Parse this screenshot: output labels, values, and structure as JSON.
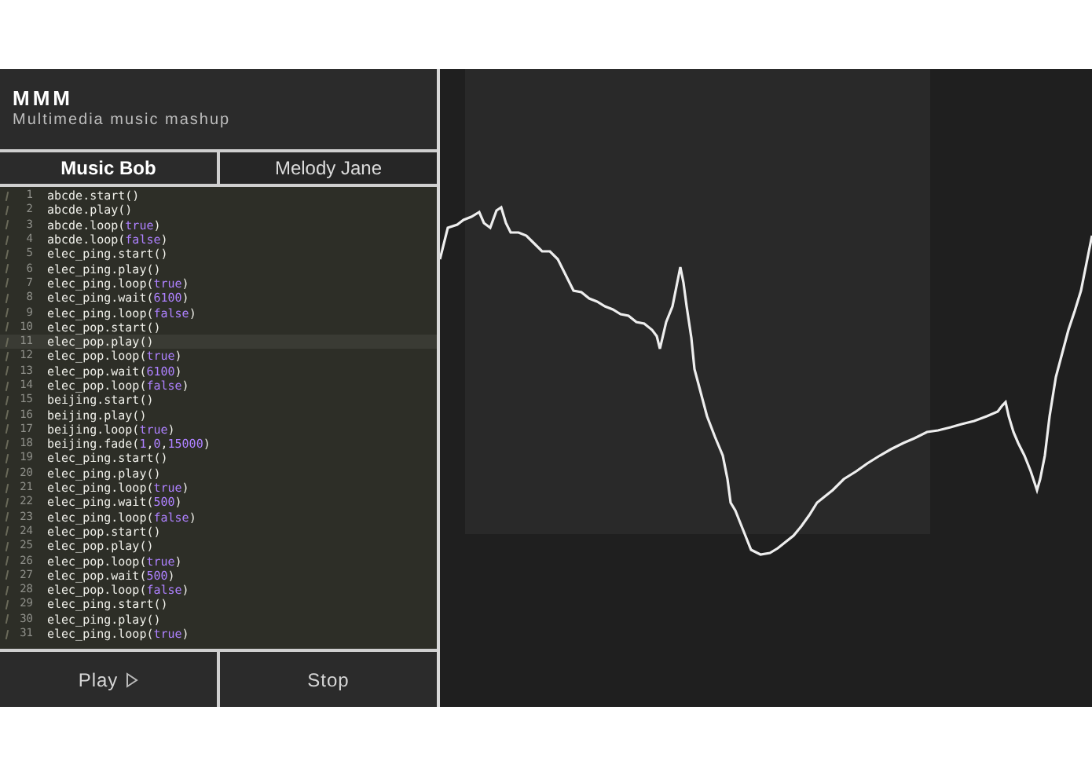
{
  "app": {
    "title": "MMM",
    "subtitle": "Multimedia music mashup"
  },
  "tabs": [
    {
      "label": "Music Bob",
      "selected": true
    },
    {
      "label": "Melody Jane",
      "selected": false
    }
  ],
  "editor": {
    "lines": [
      {
        "number": "1",
        "selected": false,
        "tokens": [
          {
            "text": "abcde.start()",
            "kind": "plain"
          }
        ]
      },
      {
        "number": "2",
        "selected": false,
        "tokens": [
          {
            "text": "abcde.play()",
            "kind": "plain"
          }
        ]
      },
      {
        "number": "3",
        "selected": false,
        "tokens": [
          {
            "text": "abcde.loop(",
            "kind": "plain"
          },
          {
            "text": "true",
            "kind": "literal"
          },
          {
            "text": ")",
            "kind": "plain"
          }
        ]
      },
      {
        "number": "4",
        "selected": false,
        "tokens": [
          {
            "text": "abcde.loop(",
            "kind": "plain"
          },
          {
            "text": "false",
            "kind": "literal"
          },
          {
            "text": ")",
            "kind": "plain"
          }
        ]
      },
      {
        "number": "5",
        "selected": false,
        "tokens": [
          {
            "text": "elec_ping.start()",
            "kind": "plain"
          }
        ]
      },
      {
        "number": "6",
        "selected": false,
        "tokens": [
          {
            "text": "elec_ping.play()",
            "kind": "plain"
          }
        ]
      },
      {
        "number": "7",
        "selected": false,
        "tokens": [
          {
            "text": "elec_ping.loop(",
            "kind": "plain"
          },
          {
            "text": "true",
            "kind": "literal"
          },
          {
            "text": ")",
            "kind": "plain"
          }
        ]
      },
      {
        "number": "8",
        "selected": false,
        "tokens": [
          {
            "text": "elec_ping.wait(",
            "kind": "plain"
          },
          {
            "text": "6100",
            "kind": "literal"
          },
          {
            "text": ")",
            "kind": "plain"
          }
        ]
      },
      {
        "number": "9",
        "selected": false,
        "tokens": [
          {
            "text": "elec_ping.loop(",
            "kind": "plain"
          },
          {
            "text": "false",
            "kind": "literal"
          },
          {
            "text": ")",
            "kind": "plain"
          }
        ]
      },
      {
        "number": "10",
        "selected": false,
        "tokens": [
          {
            "text": "elec_pop.start()",
            "kind": "plain"
          }
        ]
      },
      {
        "number": "11",
        "selected": true,
        "tokens": [
          {
            "text": "elec_pop.play()",
            "kind": "plain"
          }
        ]
      },
      {
        "number": "12",
        "selected": false,
        "tokens": [
          {
            "text": "elec_pop.loop(",
            "kind": "plain"
          },
          {
            "text": "true",
            "kind": "literal"
          },
          {
            "text": ")",
            "kind": "plain"
          }
        ]
      },
      {
        "number": "13",
        "selected": false,
        "tokens": [
          {
            "text": "elec_pop.wait(",
            "kind": "plain"
          },
          {
            "text": "6100",
            "kind": "literal"
          },
          {
            "text": ")",
            "kind": "plain"
          }
        ]
      },
      {
        "number": "14",
        "selected": false,
        "tokens": [
          {
            "text": "elec_pop.loop(",
            "kind": "plain"
          },
          {
            "text": "false",
            "kind": "literal"
          },
          {
            "text": ")",
            "kind": "plain"
          }
        ]
      },
      {
        "number": "15",
        "selected": false,
        "tokens": [
          {
            "text": "beijing.start()",
            "kind": "plain"
          }
        ]
      },
      {
        "number": "16",
        "selected": false,
        "tokens": [
          {
            "text": "beijing.play()",
            "kind": "plain"
          }
        ]
      },
      {
        "number": "17",
        "selected": false,
        "tokens": [
          {
            "text": "beijing.loop(",
            "kind": "plain"
          },
          {
            "text": "true",
            "kind": "literal"
          },
          {
            "text": ")",
            "kind": "plain"
          }
        ]
      },
      {
        "number": "18",
        "selected": false,
        "tokens": [
          {
            "text": "beijing.fade(",
            "kind": "plain"
          },
          {
            "text": "1",
            "kind": "literal"
          },
          {
            "text": ",",
            "kind": "plain"
          },
          {
            "text": "0",
            "kind": "literal"
          },
          {
            "text": ",",
            "kind": "plain"
          },
          {
            "text": "15000",
            "kind": "literal"
          },
          {
            "text": ")",
            "kind": "plain"
          }
        ]
      },
      {
        "number": "19",
        "selected": false,
        "tokens": [
          {
            "text": "elec_ping.start()",
            "kind": "plain"
          }
        ]
      },
      {
        "number": "20",
        "selected": false,
        "tokens": [
          {
            "text": "elec_ping.play()",
            "kind": "plain"
          }
        ]
      },
      {
        "number": "21",
        "selected": false,
        "tokens": [
          {
            "text": "elec_ping.loop(",
            "kind": "plain"
          },
          {
            "text": "true",
            "kind": "literal"
          },
          {
            "text": ")",
            "kind": "plain"
          }
        ]
      },
      {
        "number": "22",
        "selected": false,
        "tokens": [
          {
            "text": "elec_ping.wait(",
            "kind": "plain"
          },
          {
            "text": "500",
            "kind": "literal"
          },
          {
            "text": ")",
            "kind": "plain"
          }
        ]
      },
      {
        "number": "23",
        "selected": false,
        "tokens": [
          {
            "text": "elec_ping.loop(",
            "kind": "plain"
          },
          {
            "text": "false",
            "kind": "literal"
          },
          {
            "text": ")",
            "kind": "plain"
          }
        ]
      },
      {
        "number": "24",
        "selected": false,
        "tokens": [
          {
            "text": "elec_pop.start()",
            "kind": "plain"
          }
        ]
      },
      {
        "number": "25",
        "selected": false,
        "tokens": [
          {
            "text": "elec_pop.play()",
            "kind": "plain"
          }
        ]
      },
      {
        "number": "26",
        "selected": false,
        "tokens": [
          {
            "text": "elec_pop.loop(",
            "kind": "plain"
          },
          {
            "text": "true",
            "kind": "literal"
          },
          {
            "text": ")",
            "kind": "plain"
          }
        ]
      },
      {
        "number": "27",
        "selected": false,
        "tokens": [
          {
            "text": "elec_pop.wait(",
            "kind": "plain"
          },
          {
            "text": "500",
            "kind": "literal"
          },
          {
            "text": ")",
            "kind": "plain"
          }
        ]
      },
      {
        "number": "28",
        "selected": false,
        "tokens": [
          {
            "text": "elec_pop.loop(",
            "kind": "plain"
          },
          {
            "text": "false",
            "kind": "literal"
          },
          {
            "text": ")",
            "kind": "plain"
          }
        ]
      },
      {
        "number": "29",
        "selected": false,
        "tokens": [
          {
            "text": "elec_ping.start()",
            "kind": "plain"
          }
        ]
      },
      {
        "number": "30",
        "selected": false,
        "tokens": [
          {
            "text": "elec_ping.play()",
            "kind": "plain"
          }
        ]
      },
      {
        "number": "31",
        "selected": false,
        "tokens": [
          {
            "text": "elec_ping.loop(",
            "kind": "plain"
          },
          {
            "text": "true",
            "kind": "literal"
          },
          {
            "text": ")",
            "kind": "plain"
          }
        ]
      }
    ]
  },
  "buttons": [
    {
      "label": "Play",
      "kind": "play"
    },
    {
      "label": "Stop",
      "kind": "stop"
    }
  ]
}
